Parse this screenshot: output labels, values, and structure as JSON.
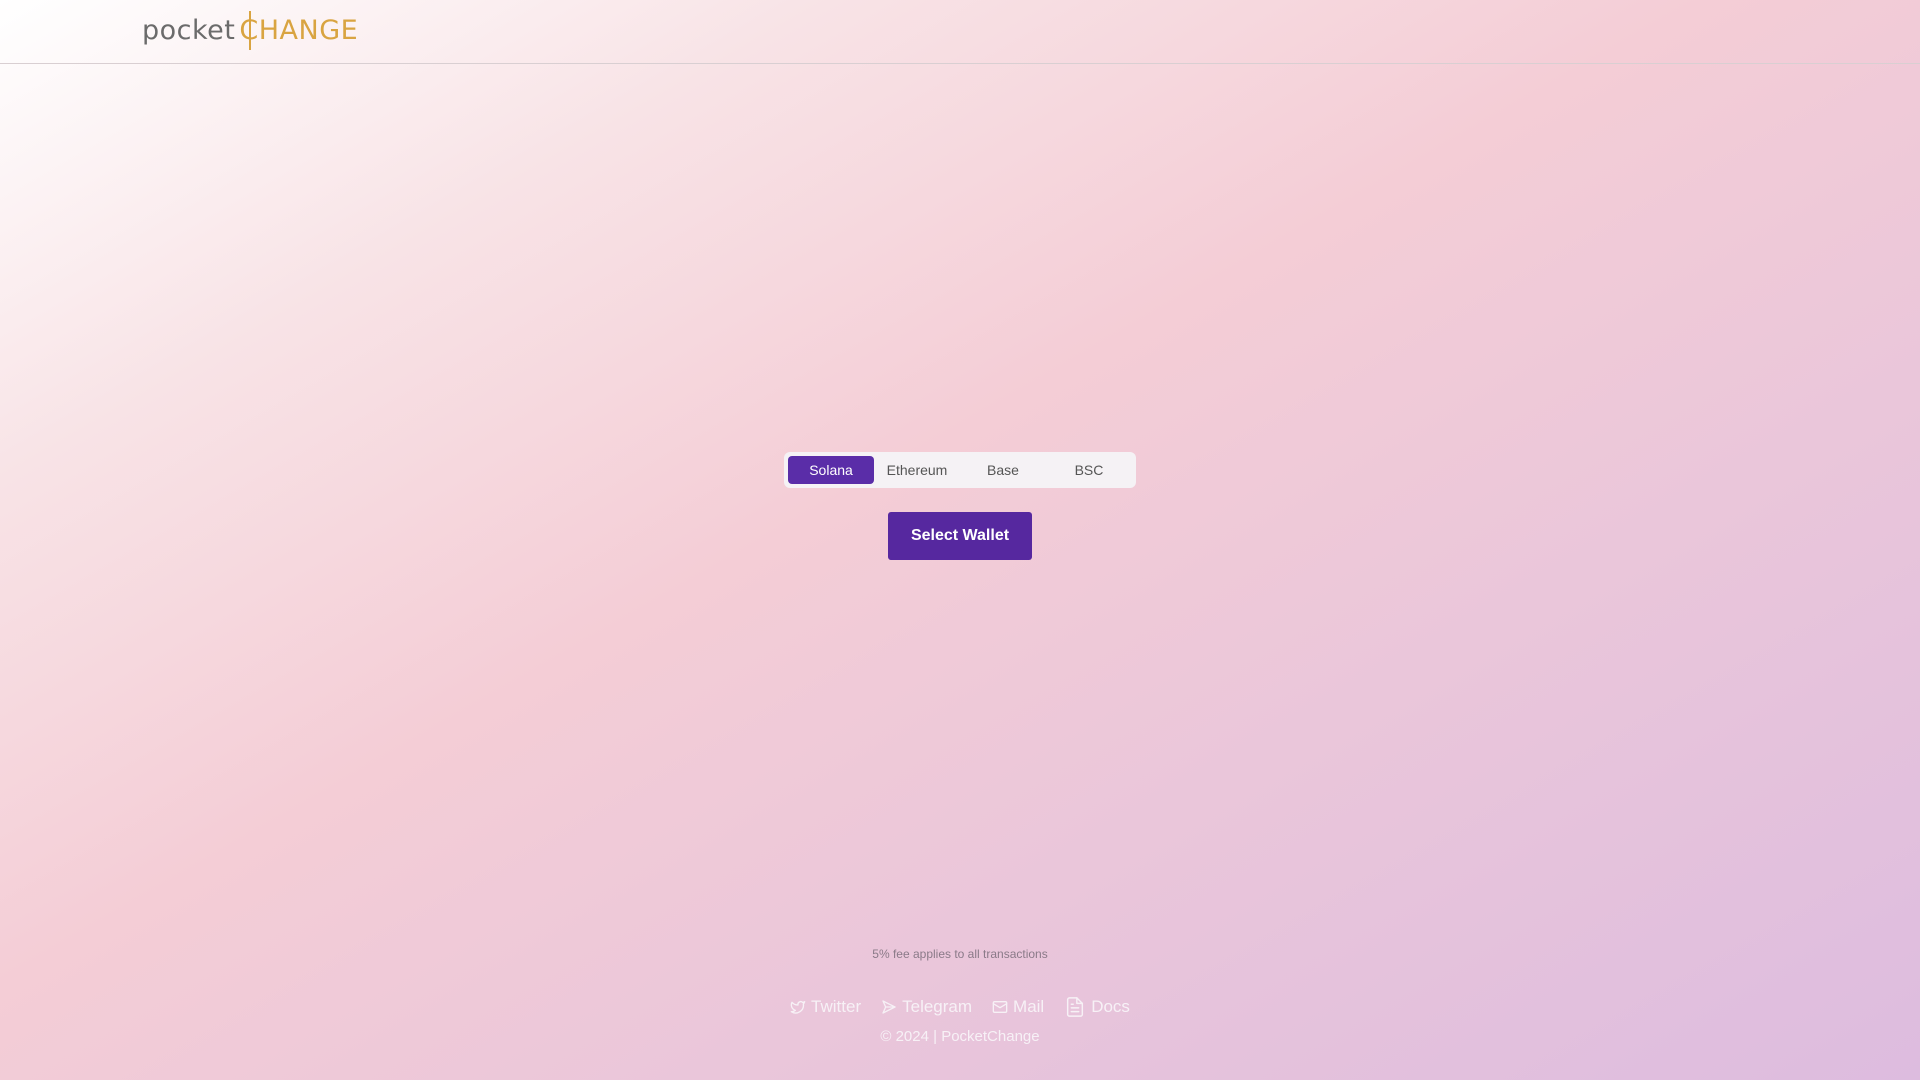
{
  "header": {
    "logo_part1": "pocket",
    "logo_part2": "CHANGE"
  },
  "chain_selector": {
    "options": [
      "Solana",
      "Ethereum",
      "Base",
      "BSC"
    ],
    "selected": "Solana"
  },
  "wallet": {
    "button_label": "Select Wallet"
  },
  "fee_note": "5% fee applies to all transactions",
  "footer": {
    "links": [
      {
        "label": "Twitter",
        "icon": "twitter-icon"
      },
      {
        "label": "Telegram",
        "icon": "send-icon"
      },
      {
        "label": "Mail",
        "icon": "mail-icon"
      },
      {
        "label": "Docs",
        "icon": "document-icon"
      }
    ],
    "copyright": "© 2024 | PocketChange"
  },
  "colors": {
    "accent": "#56289f",
    "logo_gold": "#d9a441",
    "logo_gray": "#6b6b6b"
  }
}
